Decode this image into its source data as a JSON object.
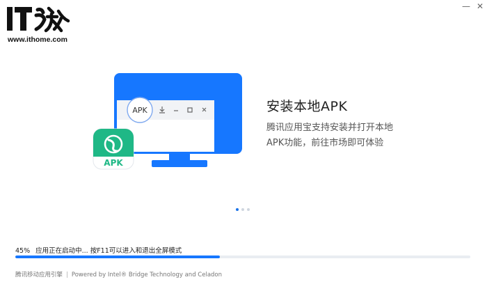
{
  "window": {
    "minimize_symbol": "—",
    "close_symbol": "✕"
  },
  "watermark": {
    "logo_text": "IT之家",
    "url": "www.ithome.com"
  },
  "illustration": {
    "mock_window_badge": "APK",
    "app_icon_label": "APK",
    "colors": {
      "monitor": "#1677ff",
      "app_icon": "#1fb886"
    },
    "icons": [
      "download-icon",
      "minimize-icon",
      "maximize-icon",
      "close-icon",
      "app-logo-icon"
    ]
  },
  "feature": {
    "title": "安装本地APK",
    "description": "腾讯应用宝支持安装并打开本地APK功能，前往市场即可体验"
  },
  "carousel": {
    "active_index": 0,
    "total": 3
  },
  "progress": {
    "percent_text": "45%",
    "percent_value": 0.45,
    "status_text": "应用正在启动中... 按F11可以进入和退出全屏模式",
    "fill_color": "#1677ff"
  },
  "footer": {
    "engine_text": "腾讯移动应用引擎",
    "separator": "|",
    "powered_text": "Powered by Intel® Bridge Technology and Celadon"
  }
}
